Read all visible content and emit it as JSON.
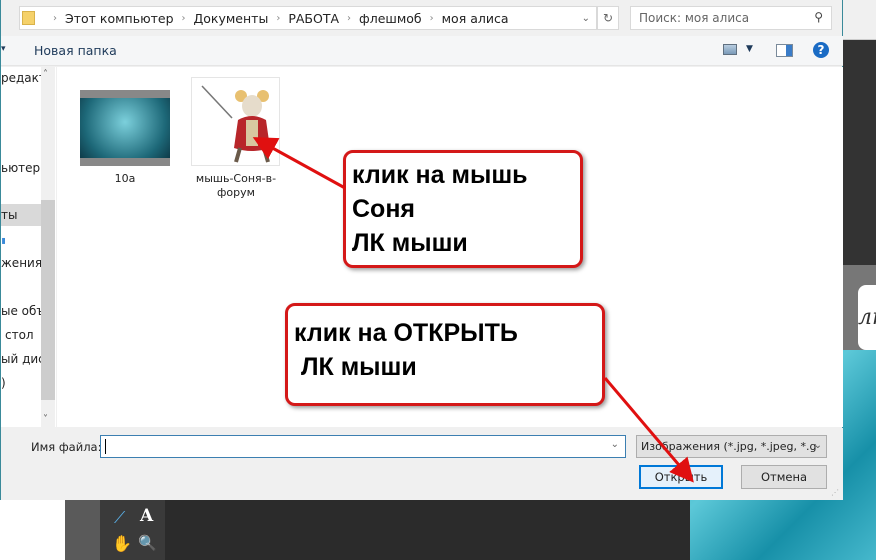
{
  "address_bar": {
    "crumbs": [
      "Этот компьютер",
      "Документы",
      "РАБОТА",
      "флешмоб",
      "моя алиса"
    ]
  },
  "search": {
    "placeholder": "Поиск: моя алиса"
  },
  "toolbar": {
    "new_folder": "Новая папка"
  },
  "nav": {
    "items": [
      "редакто",
      "ьютер",
      "ты",
      "жения",
      "ые объ",
      "стол",
      "ый дис",
      ")"
    ]
  },
  "files": [
    {
      "name": "10а"
    },
    {
      "name": "мышь-Соня-в-форум"
    }
  ],
  "footer": {
    "filename_label": "Имя файла:",
    "filename_value": "",
    "filter": "Изображения (*.jpg, *.jpeg, *.g",
    "open": "Открыть",
    "cancel": "Отмена"
  },
  "annotations": {
    "callout1": "клик на мышь\nСоня\nЛК мыши",
    "callout2": "клик на ОТКРЫТЬ\n ЛК мыши"
  },
  "background": {
    "logo_fragment": "лн"
  },
  "colors": {
    "accent": "#0078d7",
    "callout_border": "#d41818"
  }
}
